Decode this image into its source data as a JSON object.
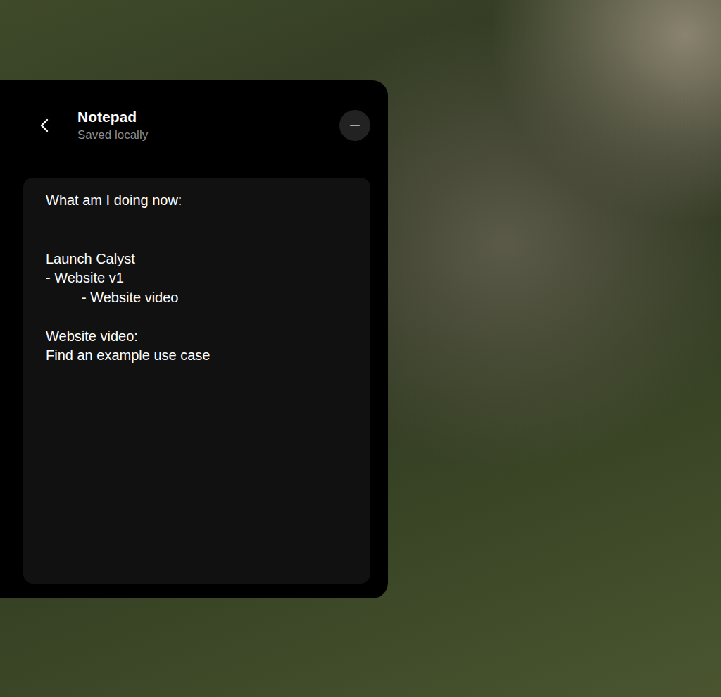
{
  "window": {
    "title": "Notepad",
    "subtitle": "Saved locally"
  },
  "note": {
    "lines": [
      {
        "text": "What am I doing now:",
        "indent": false
      },
      {
        "text": "",
        "indent": false
      },
      {
        "text": "",
        "indent": false
      },
      {
        "text": "Launch Calyst",
        "indent": false
      },
      {
        "text": "- Website v1",
        "indent": false
      },
      {
        "text": "- Website video",
        "indent": true
      },
      {
        "text": "",
        "indent": false
      },
      {
        "text": "Website video:",
        "indent": false
      },
      {
        "text": "Find an example use case",
        "indent": false
      }
    ]
  }
}
